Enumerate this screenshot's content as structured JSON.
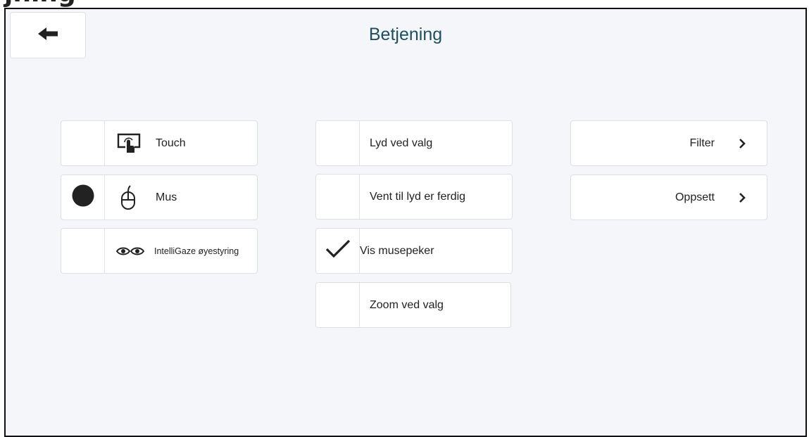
{
  "top_heading": "jning",
  "header": {
    "title": "Betjening",
    "back_icon": "arrow-left-icon"
  },
  "input_methods": [
    {
      "label": "Touch",
      "icon": "touch-screen-icon",
      "selected": false
    },
    {
      "label": "Mus",
      "icon": "mouse-icon",
      "selected": true
    },
    {
      "label": "IntelliGaze øyestyring",
      "icon": "eyes-icon",
      "selected": false
    }
  ],
  "options": [
    {
      "label": "Lyd ved valg",
      "checked": false
    },
    {
      "label": "Vent til lyd er ferdig",
      "checked": false
    },
    {
      "label": "Vis musepeker",
      "checked": true
    },
    {
      "label": "Zoom ved valg",
      "checked": false
    }
  ],
  "nav": [
    {
      "label": "Filter",
      "icon": "chevron-right-icon"
    },
    {
      "label": "Oppsett",
      "icon": "chevron-right-icon"
    }
  ],
  "colors": {
    "title": "#1f4f5c",
    "background": "#f5f6fa",
    "button": "#ffffff",
    "border": "#dcdfe5"
  }
}
